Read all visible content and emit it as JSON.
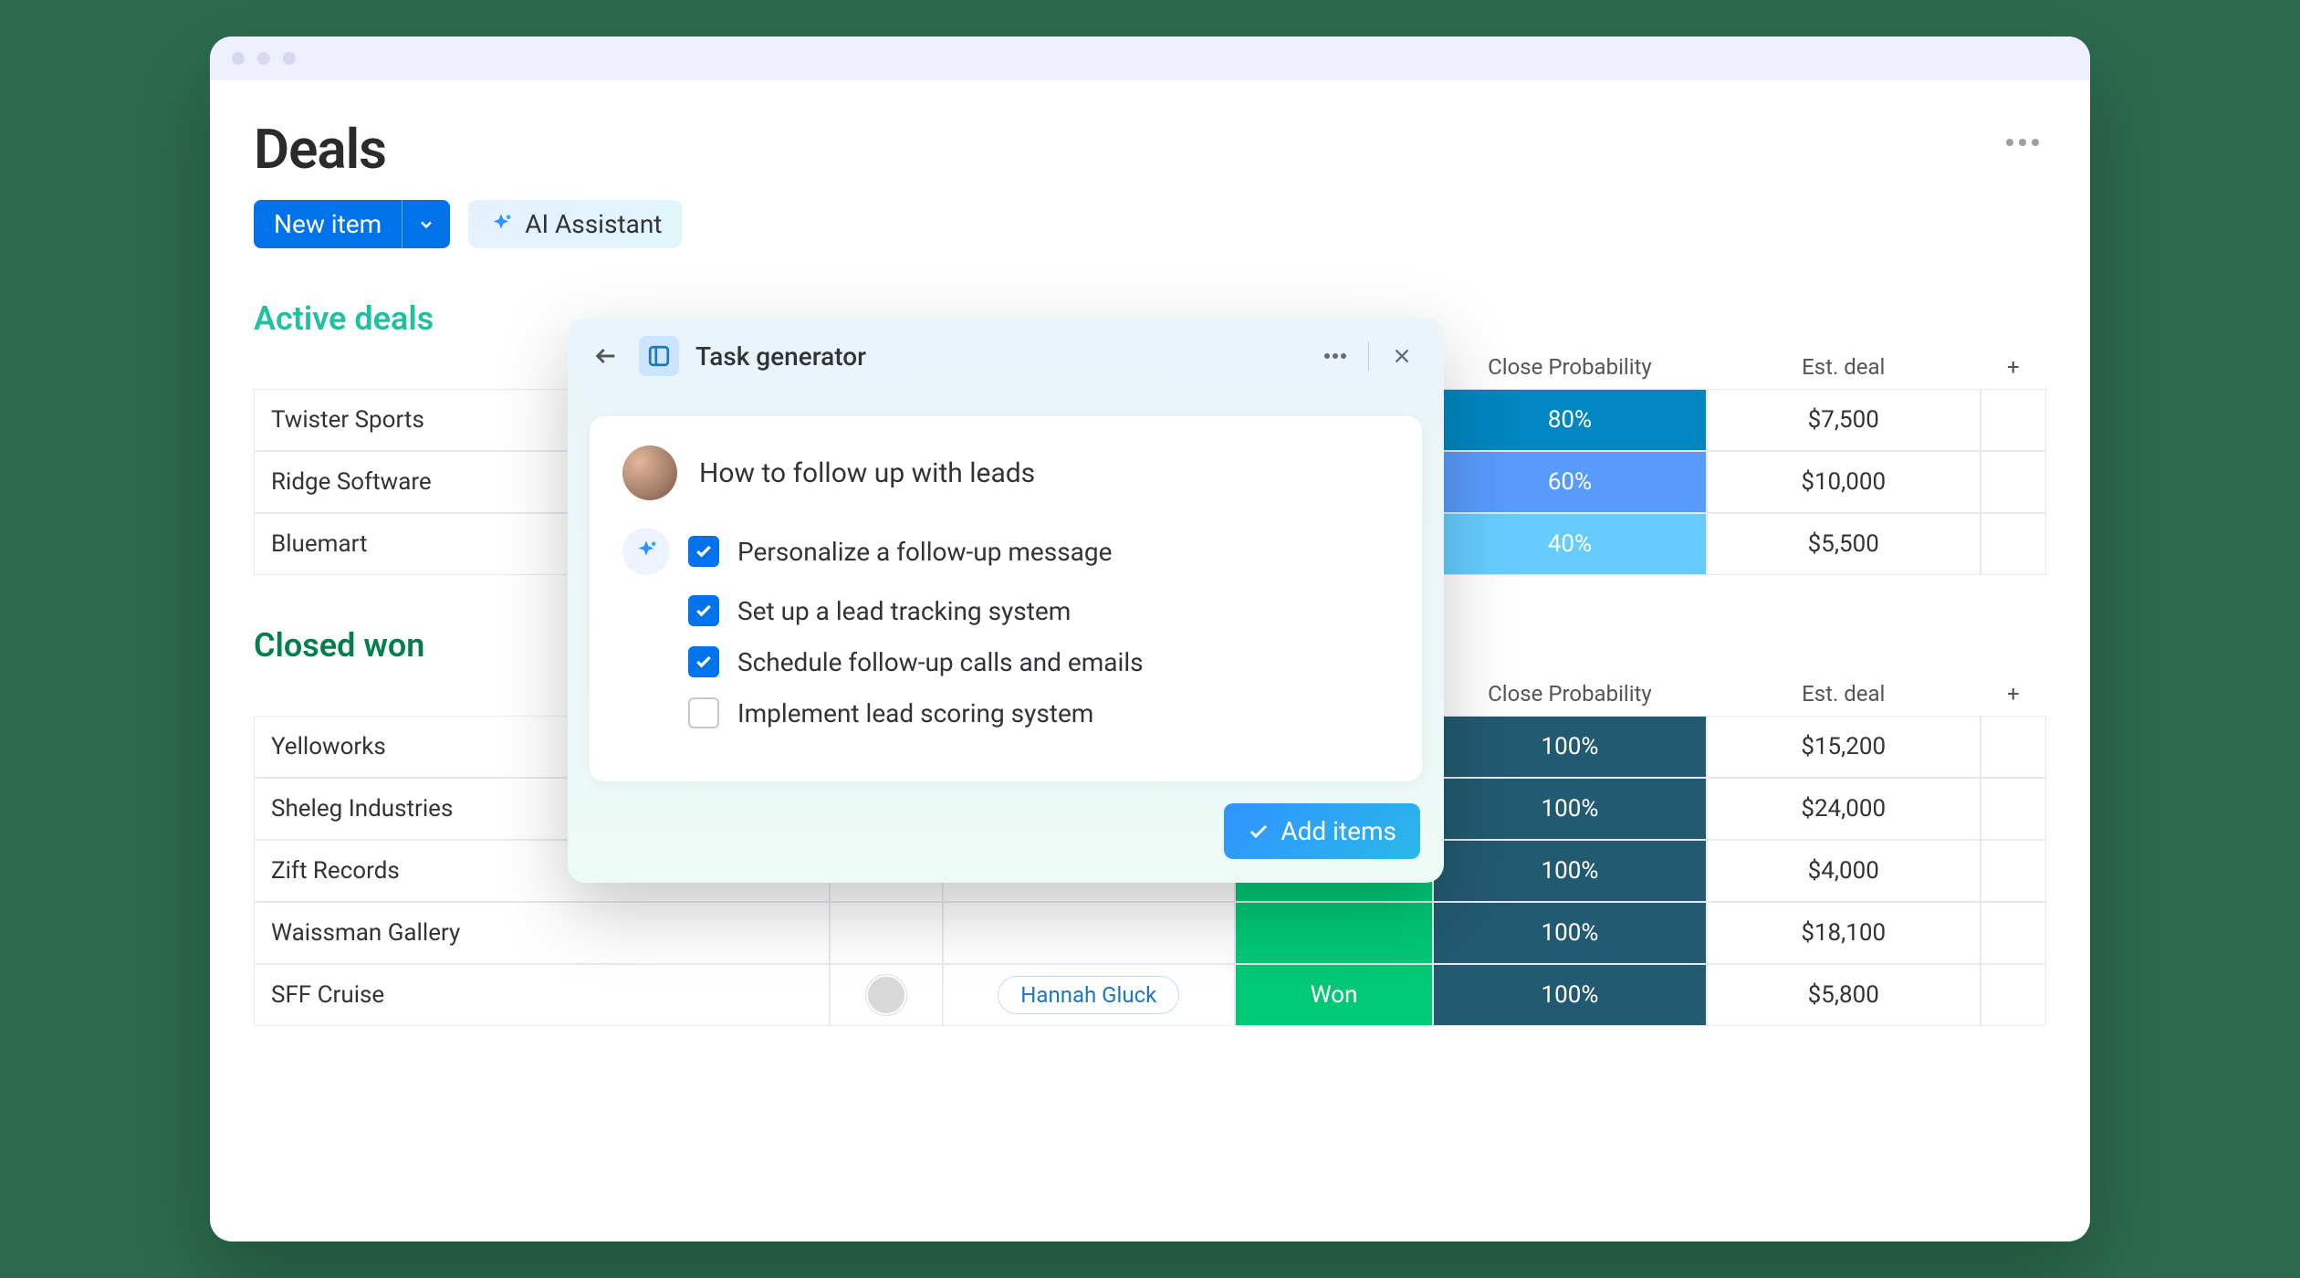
{
  "page": {
    "title": "Deals"
  },
  "toolbar": {
    "new_item": "New item",
    "ai_assistant": "AI Assistant"
  },
  "columns": {
    "close_prob": "Close Probability",
    "est_deal": "Est. deal"
  },
  "sections": {
    "active": {
      "title": "Active deals",
      "rows": [
        {
          "name": "Twister Sports",
          "prob": "80%",
          "prob_color": "#0086c0",
          "deal": "$7,500",
          "stage_color": "#401694"
        },
        {
          "name": "Ridge Software",
          "prob": "60%",
          "prob_color": "#579bfc",
          "deal": "$10,000",
          "stage_color": "#9d50dd"
        },
        {
          "name": "Bluemart",
          "prob": "40%",
          "prob_color": "#66ccff",
          "deal": "$5,500",
          "stage_color": "#c3b6f2"
        }
      ]
    },
    "won": {
      "title": "Closed won",
      "rows": [
        {
          "name": "Yelloworks",
          "prob": "100%",
          "deal": "$15,200"
        },
        {
          "name": "Sheleg Industries",
          "prob": "100%",
          "deal": "$24,000"
        },
        {
          "name": "Zift Records",
          "prob": "100%",
          "deal": "$4,000"
        },
        {
          "name": "Waissman Gallery",
          "prob": "100%",
          "deal": "$18,100"
        },
        {
          "name": "SFF Cruise",
          "contact": "Hannah Gluck",
          "stage": "Won",
          "prob": "100%",
          "deal": "$5,800"
        }
      ],
      "prob_color": "#225a71",
      "stage_color": "#00c875"
    }
  },
  "panel": {
    "title": "Task generator",
    "prompt": "How to follow up with leads",
    "tasks": [
      {
        "label": "Personalize a follow-up message",
        "checked": true
      },
      {
        "label": "Set up a lead tracking system",
        "checked": true
      },
      {
        "label": "Schedule follow-up calls and emails",
        "checked": true
      },
      {
        "label": "Implement lead scoring system",
        "checked": false
      }
    ],
    "add_button": "Add items"
  }
}
